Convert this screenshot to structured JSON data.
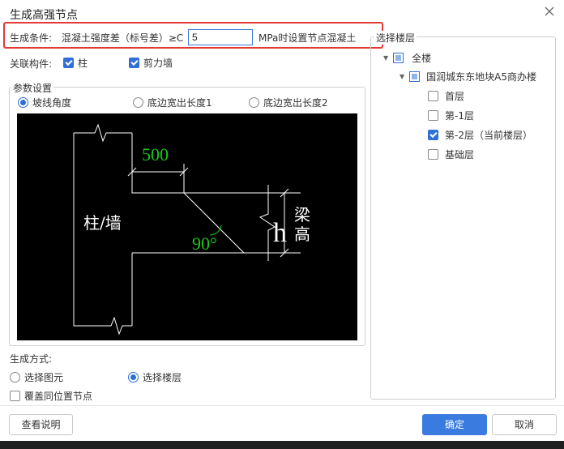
{
  "window": {
    "title": "生成高强节点"
  },
  "condition": {
    "label": "生成条件:",
    "text": "混凝土强度差（标号差）≥C",
    "value": "5",
    "unit_text": "MPa时设置节点混凝土"
  },
  "related": {
    "label": "关联构件:",
    "column": {
      "label": "柱",
      "checked": true
    },
    "shearwall": {
      "label": "剪力墙",
      "checked": true
    }
  },
  "params": {
    "title": "参数设置",
    "options": [
      {
        "label": "坡线角度",
        "selected": true
      },
      {
        "label": "底边宽出长度1",
        "selected": false
      },
      {
        "label": "底边宽出长度2",
        "selected": false
      }
    ],
    "diagram": {
      "dim_500": "500",
      "col_label": "柱/墙",
      "angle": "90°",
      "h_label": "h",
      "beam_top": "梁",
      "beam_bottom": "高"
    }
  },
  "generate_mode": {
    "title": "生成方式:",
    "options": [
      {
        "label": "选择图元",
        "selected": false
      },
      {
        "label": "选择楼层",
        "selected": true
      }
    ],
    "overwrite": {
      "label": "覆盖同位置节点",
      "checked": false
    }
  },
  "floors": {
    "title": "选择楼层",
    "root": "全楼",
    "project": "国润城东东地块A5商办楼",
    "items": [
      {
        "label": "首层",
        "checked": false
      },
      {
        "label": "第-1层",
        "checked": false
      },
      {
        "label": "第-2层（当前楼层）",
        "checked": true
      },
      {
        "label": "基础层",
        "checked": false
      }
    ]
  },
  "buttons": {
    "help": "查看说明",
    "ok": "确定",
    "cancel": "取消"
  },
  "colors": {
    "accent": "#3a7be0",
    "highlight": "#e53935",
    "diagram_bg": "#000000",
    "diagram_line": "#ffffff",
    "diagram_dim": "#19c819"
  }
}
